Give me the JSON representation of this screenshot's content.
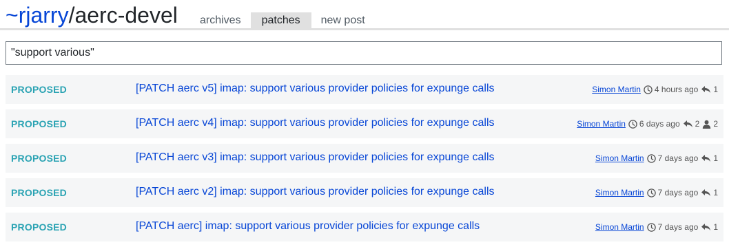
{
  "header": {
    "owner": "~rjarry",
    "separator": "/",
    "list_name": "aerc-devel",
    "tabs": [
      {
        "label": "archives"
      },
      {
        "label": "patches"
      },
      {
        "label": "new post"
      }
    ],
    "active_tab": "patches"
  },
  "search": {
    "value": "\"support various\""
  },
  "colors": {
    "link": "#0645d6",
    "status": "#2aa3b3",
    "row_bg": "#f5f6f7",
    "tab_active_bg": "#e0e0e0"
  },
  "patches": [
    {
      "status": "PROPOSED",
      "subject": "[PATCH aerc v5] imap: support various provider policies for expunge calls",
      "author": "Simon Martin",
      "time": "4 hours ago",
      "replies": "1",
      "participants": ""
    },
    {
      "status": "PROPOSED",
      "subject": "[PATCH aerc v4] imap: support various provider policies for expunge calls",
      "author": "Simon Martin",
      "time": "6 days ago",
      "replies": "2",
      "participants": "2"
    },
    {
      "status": "PROPOSED",
      "subject": "[PATCH aerc v3] imap: support various provider policies for expunge calls",
      "author": "Simon Martin",
      "time": "7 days ago",
      "replies": "1",
      "participants": ""
    },
    {
      "status": "PROPOSED",
      "subject": "[PATCH aerc v2] imap: support various provider policies for expunge calls",
      "author": "Simon Martin",
      "time": "7 days ago",
      "replies": "1",
      "participants": ""
    },
    {
      "status": "PROPOSED",
      "subject": "[PATCH aerc] imap: support various provider policies for expunge calls",
      "author": "Simon Martin",
      "time": "7 days ago",
      "replies": "1",
      "participants": ""
    }
  ],
  "icons": {
    "time": "clock-icon",
    "replies": "reply-icon",
    "participants": "user-icon"
  }
}
